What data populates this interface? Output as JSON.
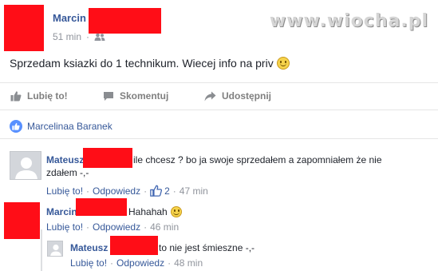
{
  "post": {
    "author": "Marcin",
    "time": "51 min",
    "audience_icon": "friends-icon",
    "text": "Sprzedam ksiazki do 1 technikum. Wiecej info na priv",
    "emoji": "smiley"
  },
  "watermark": "www.wiocha.pl",
  "actions": {
    "like": "Lubię to!",
    "comment": "Skomentuj",
    "share": "Udostępnij"
  },
  "likers": "Marcelinaa Baranek",
  "comments": [
    {
      "author": "Mateusz",
      "text_line1": "ile chcesz ? bo ja swoje sprzedałem a zapomniałem że nie",
      "text_line2": "zdałem -,-",
      "like": "Lubię to!",
      "sep": "·",
      "reply": "Odpowiedz",
      "likes": "2",
      "time": "47 min"
    },
    {
      "author": "Marcin",
      "text": "Hahahah",
      "like": "Lubię to!",
      "sep": "·",
      "reply": "Odpowiedz",
      "time": "46 min"
    }
  ],
  "reply": {
    "author": "Mateusz",
    "text": "to nie jest śmieszne -,-",
    "like": "Lubię to!",
    "sep": "·",
    "reply": "Odpowiedz",
    "time": "48 min"
  },
  "colors": {
    "redaction": "#ff0d17",
    "link": "#365899",
    "muted": "#90949c"
  }
}
